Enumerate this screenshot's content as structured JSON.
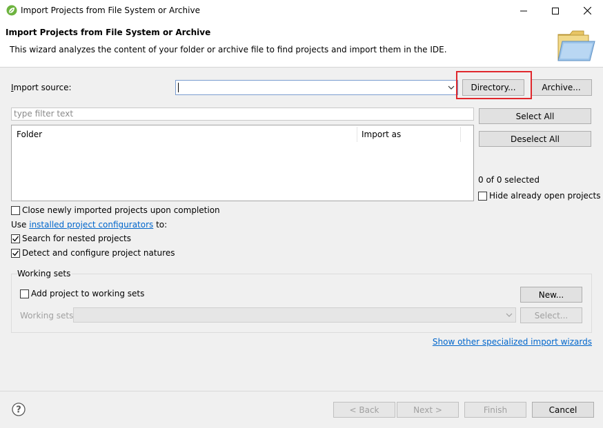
{
  "window": {
    "title": "Import Projects from File System or Archive",
    "icons": {
      "app": "spring-leaf-icon",
      "minimize": "minimize-icon",
      "maximize": "maximize-icon",
      "close": "close-icon"
    }
  },
  "banner": {
    "title": "Import Projects from File System or Archive",
    "description": "This wizard analyzes the content of your folder or archive file to find projects and import them in the IDE.",
    "icon": "folder-icon"
  },
  "import_source": {
    "label": "Import source:",
    "value": "",
    "directory_button": "Directory...",
    "archive_button": "Archive..."
  },
  "filter": {
    "placeholder": "type filter text"
  },
  "table": {
    "columns": [
      "Folder",
      "Import as"
    ],
    "rows": []
  },
  "side": {
    "select_all": "Select All",
    "deselect_all": "Deselect All",
    "selected_count": "0 of 0 selected",
    "hide_open_label": "Hide already open projects",
    "hide_open_checked": false
  },
  "options": {
    "close_imported_label": "Close newly imported projects upon completion",
    "close_imported_checked": false,
    "use_prefix": "Use ",
    "configurators_link": "installed project configurators",
    "use_suffix": " to:",
    "search_nested_label": "Search for nested projects",
    "search_nested_checked": true,
    "detect_natures_label": "Detect and configure project natures",
    "detect_natures_checked": true
  },
  "working_sets": {
    "group_label": "Working sets",
    "add_label": "Add project to working sets",
    "add_checked": false,
    "new_button": "New...",
    "sets_label": "Working sets:",
    "sets_value": "",
    "select_button": "Select..."
  },
  "wizards_link": "Show other specialized import wizards",
  "footer": {
    "back": "< Back",
    "next": "Next >",
    "finish": "Finish",
    "cancel": "Cancel",
    "help_icon": "help-icon"
  },
  "colors": {
    "highlight": "#e0262b",
    "link": "#0066cc",
    "background": "#f0f0f0"
  }
}
